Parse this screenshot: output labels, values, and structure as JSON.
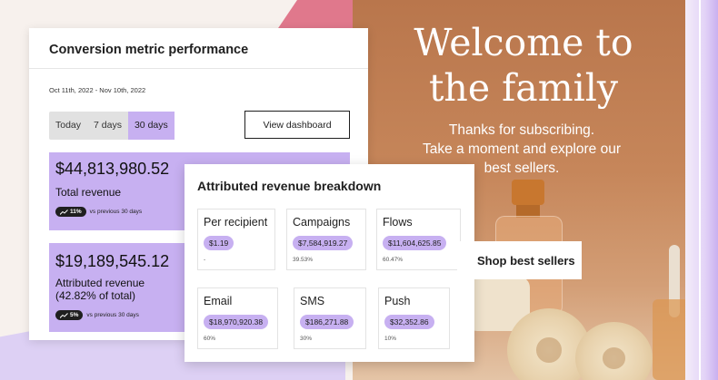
{
  "conversion": {
    "title": "Conversion metric performance",
    "date_range": "Oct 11th, 2022 - Nov 10th, 2022",
    "periods": [
      "Today",
      "7 days",
      "30 days"
    ],
    "active_period": "30 days",
    "view_button": "View dashboard",
    "metrics": [
      {
        "value": "$44,813,980.52",
        "label": "Total revenue",
        "change": "11%",
        "comparison": "vs previous 30 days"
      },
      {
        "value": "$19,189,545.12",
        "label_line1": "Attributed revenue",
        "label_line2": "(42.82% of total)",
        "change": "5%",
        "comparison": "vs previous 30 days"
      }
    ]
  },
  "breakdown": {
    "title": "Attributed revenue breakdown",
    "tiles": [
      {
        "label": "Per recipient",
        "value": "$1.19",
        "pct": "-"
      },
      {
        "label": "Campaigns",
        "value": "$7,584,919.27",
        "pct": "39.53%"
      },
      {
        "label": "Flows",
        "value": "$11,604,625.85",
        "pct": "60.47%"
      },
      {
        "label": "Email",
        "value": "$18,970,920.38",
        "pct": "60%"
      },
      {
        "label": "SMS",
        "value": "$186,271.88",
        "pct": "30%"
      },
      {
        "label": "Push",
        "value": "$32,352.86",
        "pct": "10%"
      }
    ]
  },
  "hero": {
    "title_line1": "Welcome to",
    "title_line2": "the family",
    "sub_line1": "Thanks for subscribing.",
    "sub_line2": "Take a moment and explore our",
    "sub_line3": "best sellers.",
    "button": "Shop best sellers"
  },
  "colors": {
    "accent": "#c7b0f1",
    "hero_bg": "#c6865a",
    "dark": "#1f1f1f"
  },
  "icons": {
    "trend": "trend-up-icon"
  }
}
